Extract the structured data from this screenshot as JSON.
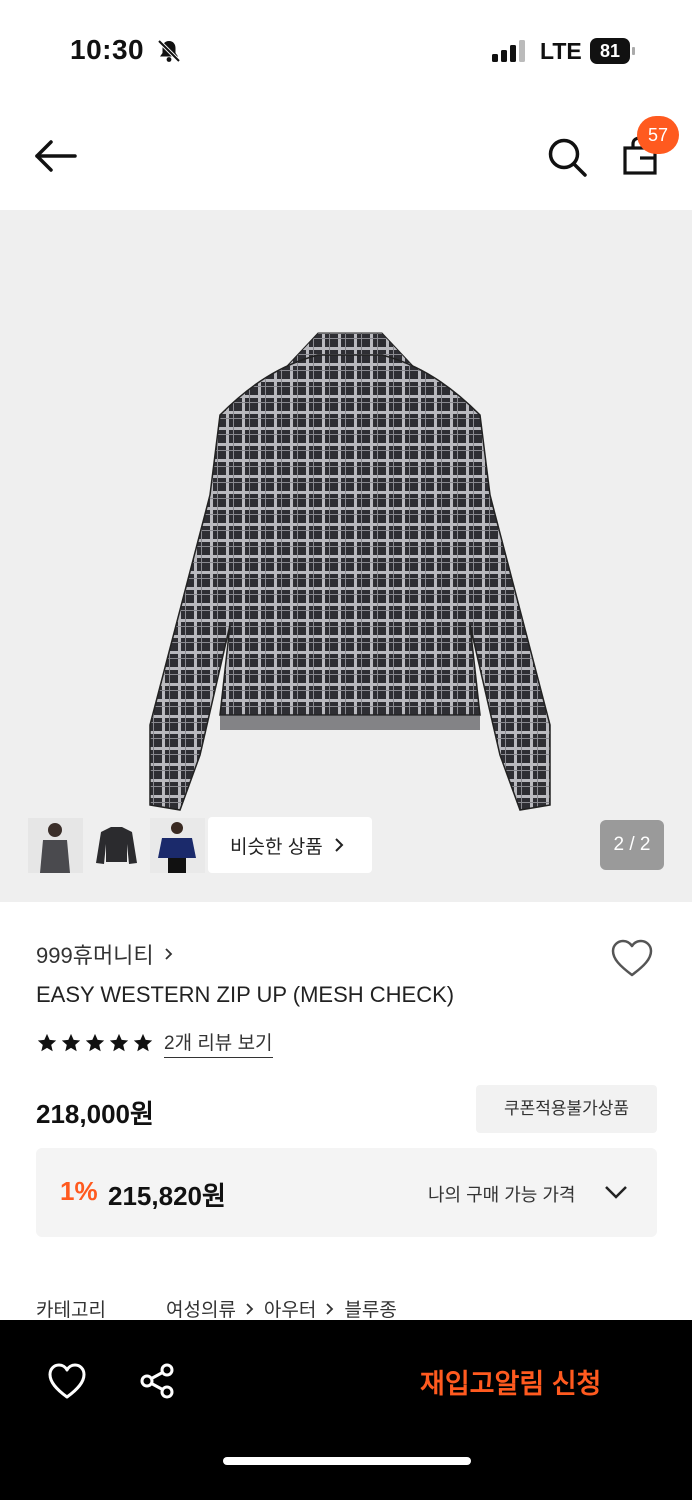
{
  "status": {
    "time": "10:30",
    "network": "LTE",
    "battery": "81"
  },
  "header": {
    "cart_count": "57"
  },
  "gallery": {
    "similar_label": "비슷한 상품",
    "page_counter": "2 / 2",
    "background_color": "#efefef"
  },
  "product": {
    "brand": "999휴머니티",
    "title": "EASY WESTERN ZIP UP (MESH CHECK)",
    "rating_stars": 5,
    "review_link": "2개 리뷰 보기",
    "price": "218,000원",
    "coupon_badge": "쿠폰적용불가상품",
    "discount_rate": "1%",
    "discount_price": "215,820원",
    "my_price_label": "나의 구매 가능 가격"
  },
  "category": {
    "label": "카테고리",
    "path": [
      "여성의류",
      "아우터",
      "블루종"
    ]
  },
  "bottom_bar": {
    "restock_label": "재입고알림 신청"
  },
  "colors": {
    "accent": "#ff5a1f",
    "bottom_bar": "#000000"
  },
  "icons": [
    "bell-slash-icon",
    "signal-icon",
    "back-arrow-icon",
    "search-icon",
    "shopping-bag-icon",
    "heart-icon",
    "star-icon",
    "chevron-right-icon",
    "chevron-down-icon",
    "share-icon"
  ]
}
